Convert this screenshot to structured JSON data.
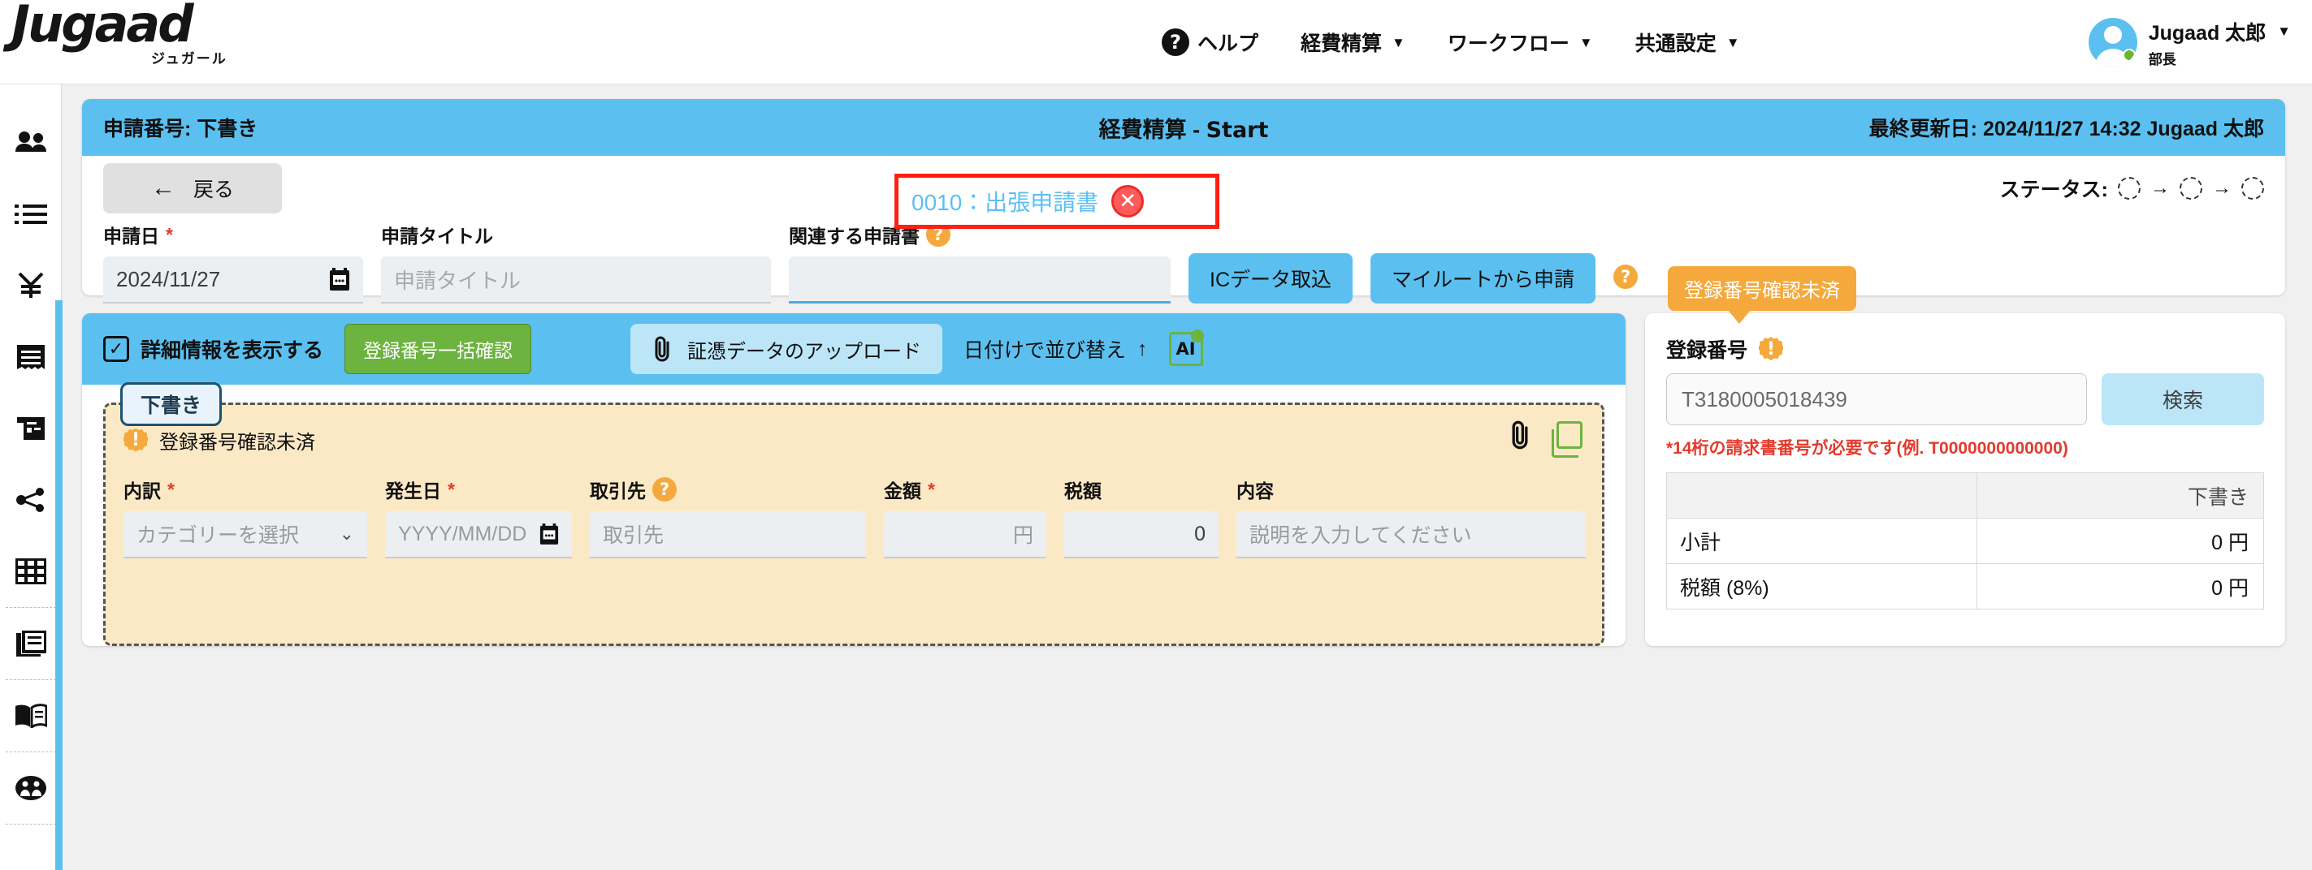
{
  "header": {
    "logo_text": "Jugaad",
    "logo_sub": "ジュガール",
    "nav": [
      {
        "label": "ヘルプ",
        "icon": "question-mark-icon",
        "has_caret": false
      },
      {
        "label": "経費精算",
        "icon": "",
        "has_caret": true
      },
      {
        "label": "ワークフロー",
        "icon": "",
        "has_caret": true
      },
      {
        "label": "共通設定",
        "icon": "",
        "has_caret": true
      }
    ],
    "help_glyph": "?",
    "caret_glyph": "▼",
    "user": {
      "name": "Jugaad 太郎",
      "role": "部長"
    }
  },
  "sidebar": {
    "items": [
      {
        "name": "users-icon"
      },
      {
        "name": "list-icon"
      },
      {
        "name": "yen-icon"
      },
      {
        "name": "receipt-icon"
      },
      {
        "name": "invoice-icon"
      },
      {
        "name": "share-icon"
      },
      {
        "name": "table-icon"
      },
      {
        "name": "documents-icon"
      },
      {
        "name": "book-icon"
      },
      {
        "name": "people-circle-icon"
      }
    ]
  },
  "doc_header": {
    "application_no_label": "申請番号: 下書き",
    "title_prefix": "経費精算 - ",
    "title_suffix": "Start",
    "last_updated": "最終更新日: 2024/11/27 14:32 Jugaad 太郎",
    "back_button": "戻る",
    "back_arrow": "←",
    "status_label": "ステータス:",
    "status_steps": 3,
    "status_arrow": "→"
  },
  "form": {
    "application_date": {
      "label": "申請日",
      "required": "*",
      "value": "2024/11/27",
      "calendar_icon": "📅"
    },
    "application_title": {
      "label": "申請タイトル",
      "placeholder": "申請タイトル",
      "value": ""
    },
    "related_application": {
      "label": "関連する申請書",
      "help_glyph": "?",
      "selected_text": "0010：出張申請書",
      "remove_glyph": "✕",
      "value": ""
    },
    "ic_import_button": "ICデータ取込",
    "myroute_button": "マイルートから申請",
    "myroute_help_glyph": "?"
  },
  "toolbar": {
    "detail_checkbox": {
      "label": "詳細情報を表示する",
      "checked": true,
      "check_glyph": "✓"
    },
    "bulk_confirm_button": "登録番号一括確認",
    "upload_button": {
      "label": "証憑データのアップロード",
      "icon_glyph": "🖇"
    },
    "sort_label": "日付けで並び替え",
    "sort_arrow": "↑",
    "ai_label": "AI"
  },
  "item_card": {
    "draft_badge": "下書き",
    "warning_text": "登録番号確認未済",
    "warning_glyph": "!",
    "attach_icon_glyph": "🖇",
    "fields": [
      {
        "label": "内訳",
        "required": "*",
        "value": "カテゴリーを選択",
        "chevron": "⌄",
        "type": "select"
      },
      {
        "label": "発生日",
        "required": "*",
        "value": "YYYY/MM/DD",
        "calendar_icon": "📅",
        "type": "date"
      },
      {
        "label": "取引先",
        "required": "",
        "help_glyph": "?",
        "value": "取引先",
        "type": "text"
      },
      {
        "label": "金額",
        "required": "*",
        "value": "円",
        "type": "amount"
      },
      {
        "label": "税額",
        "required": "",
        "value": "0",
        "type": "amount"
      },
      {
        "label": "内容",
        "required": "",
        "value": "説明を入力してください",
        "type": "text"
      }
    ]
  },
  "right_panel": {
    "tooltip": "登録番号確認未済",
    "registration_label": "登録番号",
    "warning_glyph": "!",
    "registration_value": "T3180005018439",
    "search_button": "検索",
    "hint": "*14桁の請求書番号が必要です(例. T0000000000000)",
    "summary": {
      "col_header": "下書き",
      "rows": [
        {
          "label": "小計",
          "value": "0 円"
        },
        {
          "label": "税額 (8%)",
          "value": "0 円"
        }
      ]
    }
  },
  "colors": {
    "accent_blue": "#5bc0f0",
    "green": "#6cb33f",
    "orange": "#f5a93c",
    "red": "#e23b2e",
    "annotation_red": "#ff1f14"
  }
}
